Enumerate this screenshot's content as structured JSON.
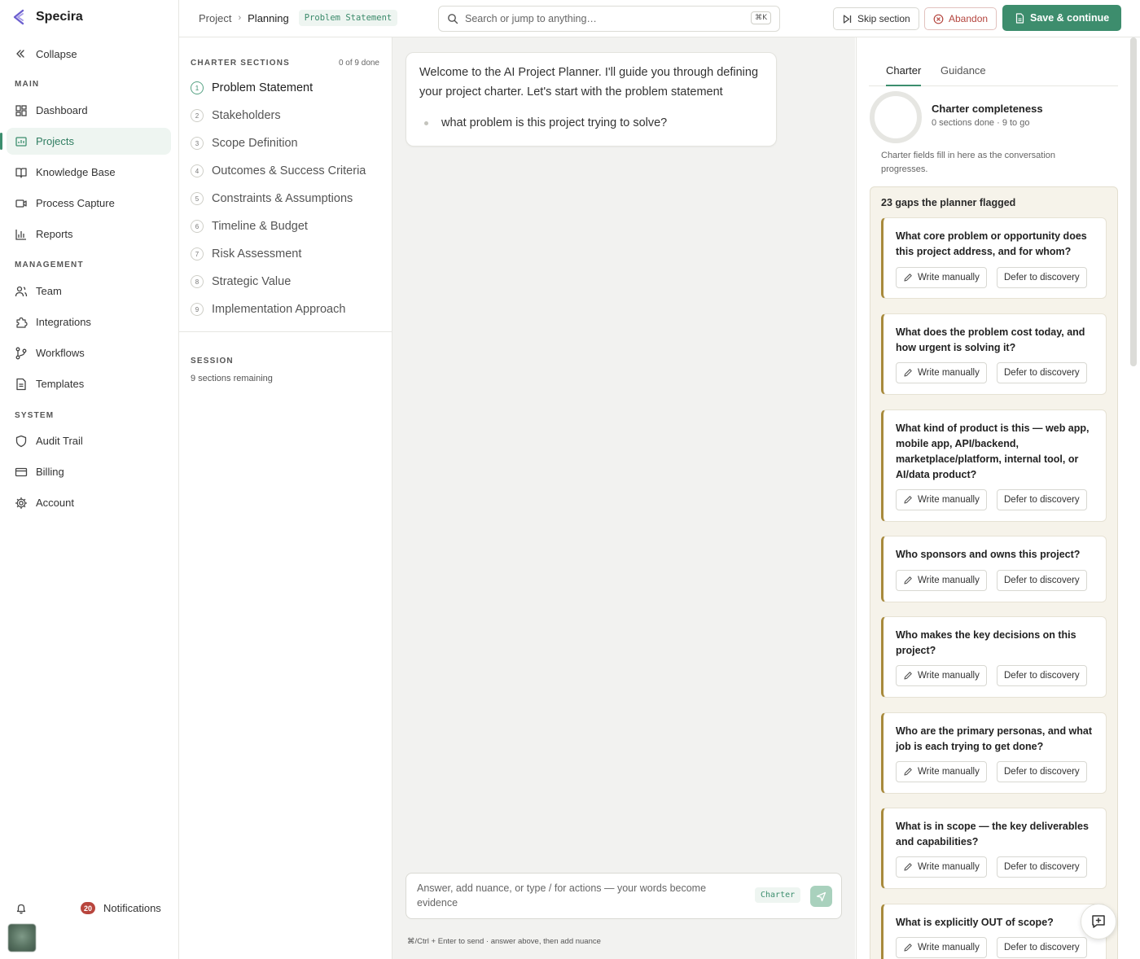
{
  "app": {
    "name": "Specira"
  },
  "sidebar": {
    "collapse_label": "Collapse",
    "sections": {
      "main": "MAIN",
      "management": "MANAGEMENT",
      "system": "SYSTEM"
    },
    "items": [
      {
        "label": "Dashboard",
        "icon": "dashboard-icon"
      },
      {
        "label": "Projects",
        "icon": "projects-icon",
        "active": true
      },
      {
        "label": "Knowledge Base",
        "icon": "book-icon"
      },
      {
        "label": "Process Capture",
        "icon": "video-icon"
      },
      {
        "label": "Reports",
        "icon": "bar-chart-icon"
      },
      {
        "label": "Team",
        "icon": "users-icon"
      },
      {
        "label": "Integrations",
        "icon": "puzzle-icon"
      },
      {
        "label": "Workflows",
        "icon": "git-branch-icon"
      },
      {
        "label": "Templates",
        "icon": "file-icon"
      },
      {
        "label": "Audit Trail",
        "icon": "shield-icon"
      },
      {
        "label": "Billing",
        "icon": "credit-card-icon"
      },
      {
        "label": "Account",
        "icon": "gear-icon"
      }
    ],
    "notifications": {
      "count": "20",
      "label": "Notifications"
    }
  },
  "header": {
    "breadcrumb": [
      "Project",
      "Planning"
    ],
    "section_pill": "Problem Statement",
    "search": {
      "placeholder": "Search or jump to anything…",
      "shortcut": "⌘K"
    },
    "skip_label": "Skip section",
    "abandon_label": "Abandon",
    "save_label": "Save & continue"
  },
  "charter_sections": {
    "heading": "CHARTER SECTIONS",
    "progress": "0 of 9 done",
    "items": [
      {
        "num": "1",
        "label": "Problem Statement",
        "active": true
      },
      {
        "num": "2",
        "label": "Stakeholders"
      },
      {
        "num": "3",
        "label": "Scope Definition"
      },
      {
        "num": "4",
        "label": "Outcomes & Success Criteria"
      },
      {
        "num": "5",
        "label": "Constraints & Assumptions"
      },
      {
        "num": "6",
        "label": "Timeline & Budget"
      },
      {
        "num": "7",
        "label": "Risk Assessment"
      },
      {
        "num": "8",
        "label": "Strategic Value"
      },
      {
        "num": "9",
        "label": "Implementation Approach"
      }
    ],
    "session_heading": "SESSION",
    "session_text": "9 sections remaining"
  },
  "chat": {
    "welcome": "Welcome to the AI Project Planner. I'll guide you through defining your project charter. Let's start with the problem statement",
    "question": "what problem is this project trying to solve?",
    "composer_placeholder": "Answer, add nuance, or type / for actions — your words become evidence",
    "composer_chip": "Charter",
    "hint": "⌘/Ctrl + Enter to send · answer above, then add nuance"
  },
  "panel": {
    "tabs": [
      "Charter",
      "Guidance"
    ],
    "completeness_title": "Charter completeness",
    "completeness_sub": "0 sections done · 9 to go",
    "completeness_note": "Charter fields fill in here as the conversation progresses.",
    "gaps_title": "23 gaps the planner flagged",
    "write_label": "Write manually",
    "defer_label": "Defer to discovery",
    "gaps": [
      "What core problem or opportunity does this project address, and for whom?",
      "What does the problem cost today, and how urgent is solving it?",
      "What kind of product is this — web app, mobile app, API/backend, marketplace/platform, internal tool, or AI/data product?",
      "Who sponsors and owns this project?",
      "Who makes the key decisions on this project?",
      "Who are the primary personas, and what job is each trying to get done?",
      "What is in scope — the key deliverables and capabilities?",
      "What is explicitly OUT of scope?"
    ]
  },
  "colors": {
    "accent": "#3d8d6d",
    "danger": "#b4453e",
    "gap_border": "#a88a3c"
  }
}
